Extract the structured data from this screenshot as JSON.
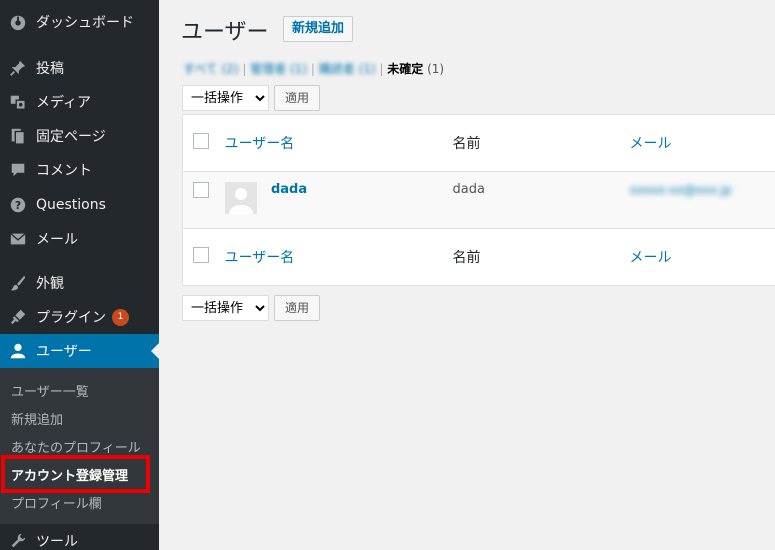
{
  "sidebar": {
    "items": [
      {
        "label": "ダッシュボード",
        "icon": "dashboard-icon"
      },
      {
        "label": "投稿",
        "icon": "pin-icon"
      },
      {
        "label": "メディア",
        "icon": "media-icon"
      },
      {
        "label": "固定ページ",
        "icon": "page-icon"
      },
      {
        "label": "コメント",
        "icon": "comment-icon"
      },
      {
        "label": "Questions",
        "icon": "question-icon"
      },
      {
        "label": "メール",
        "icon": "mail-icon"
      },
      {
        "label": "外観",
        "icon": "brush-icon"
      },
      {
        "label": "プラグイン",
        "icon": "plugin-icon",
        "badge": "1"
      },
      {
        "label": "ユーザー",
        "icon": "user-icon"
      },
      {
        "label": "ツール",
        "icon": "wrench-icon"
      }
    ],
    "submenu": [
      {
        "label": "ユーザー一覧"
      },
      {
        "label": "新規追加"
      },
      {
        "label": "あなたのプロフィール"
      },
      {
        "label": "アカウント登録管理"
      },
      {
        "label": "プロフィール欄"
      }
    ]
  },
  "main": {
    "title": "ユーザー",
    "add_new": "新規追加",
    "filters": {
      "all": "すべて (2)",
      "admin": "管理者 (1)",
      "editor": "購読者 (1)",
      "pending": "未確定",
      "pending_count": "(1)"
    },
    "bulk_select": "一括操作",
    "apply": "適用",
    "table": {
      "col_username": "ユーザー名",
      "col_name": "名前",
      "col_email": "メール",
      "rows": [
        {
          "username": "dada",
          "name": "dada",
          "email": "xxxxx-xx@xxx.jp"
        }
      ]
    }
  },
  "colors": {
    "sidebar_bg": "#23282d",
    "active_bg": "#0073aa",
    "link": "#0073aa",
    "highlight_box": "#e00000"
  }
}
